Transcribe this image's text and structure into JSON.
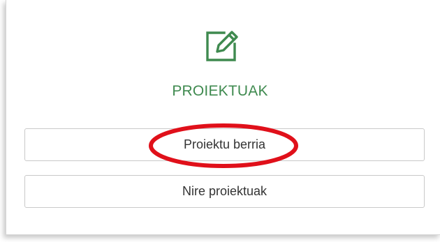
{
  "colors": {
    "accent": "#3f8a4f",
    "highlight": "#e0101a",
    "button_border": "#c9c9c9",
    "text": "#333333"
  },
  "header": {
    "icon": "edit-icon",
    "title": "PROIEKTUAK"
  },
  "actions": {
    "new_project_label": "Proiektu berria",
    "my_projects_label": "Nire proiektuak"
  },
  "annotation": {
    "shape": "red-ellipse",
    "target": "new-project-button"
  }
}
